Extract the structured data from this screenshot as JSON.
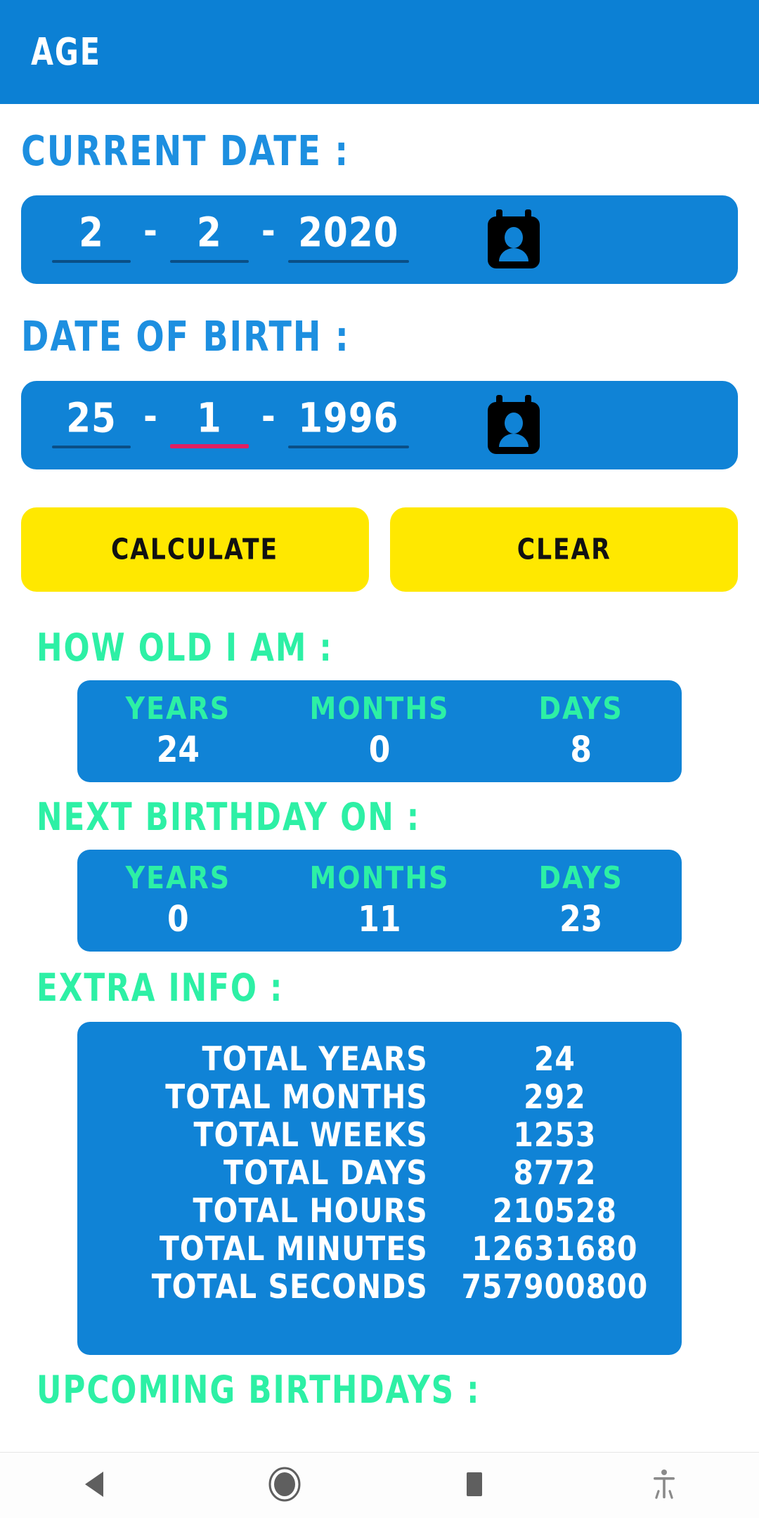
{
  "app": {
    "title": "AGE",
    "accent_blue": "#0c80d4",
    "card_blue": "#1083d6",
    "label_blue": "#1d8fe0",
    "result_green": "#2df0a5",
    "button_yellow": "#ffe800",
    "focus_pink": "#e01f62",
    "underline_navy": "#0a4f86"
  },
  "current_date": {
    "label": "CURRENT DATE :",
    "day": "2",
    "month": "2",
    "year": "2020",
    "separator": "-",
    "picker_icon": "contact-calendar-icon"
  },
  "date_of_birth": {
    "label": "DATE OF BIRTH :",
    "day": "25",
    "month": "1",
    "year": "1996",
    "separator": "-",
    "focused_field": "month",
    "picker_icon": "contact-calendar-icon"
  },
  "buttons": {
    "calculate": "CALCULATE",
    "clear": "CLEAR"
  },
  "how_old": {
    "label": "HOW OLD I AM :",
    "columns": [
      {
        "head": "YEARS",
        "value": "24"
      },
      {
        "head": "MONTHS",
        "value": "0"
      },
      {
        "head": "DAYS",
        "value": "8"
      }
    ]
  },
  "next_birthday": {
    "label": "NEXT BIRTHDAY ON :",
    "columns": [
      {
        "head": "YEARS",
        "value": "0"
      },
      {
        "head": "MONTHS",
        "value": "11"
      },
      {
        "head": "DAYS",
        "value": "23"
      }
    ]
  },
  "extra_info": {
    "label": "EXTRA INFO :",
    "rows": [
      {
        "label": "TOTAL YEARS",
        "value": "24"
      },
      {
        "label": "TOTAL MONTHS",
        "value": "292"
      },
      {
        "label": "TOTAL WEEKS",
        "value": "1253"
      },
      {
        "label": "TOTAL DAYS",
        "value": "8772"
      },
      {
        "label": "TOTAL HOURS",
        "value": "210528"
      },
      {
        "label": "TOTAL MINUTES",
        "value": "12631680"
      },
      {
        "label": "TOTAL SECONDS",
        "value": "757900800"
      }
    ]
  },
  "upcoming": {
    "label": "UPCOMING BIRTHDAYS :"
  },
  "navbar": {
    "back": "back-triangle-icon",
    "home": "home-circle-icon",
    "recents": "recents-square-icon",
    "accessibility": "accessibility-icon"
  }
}
